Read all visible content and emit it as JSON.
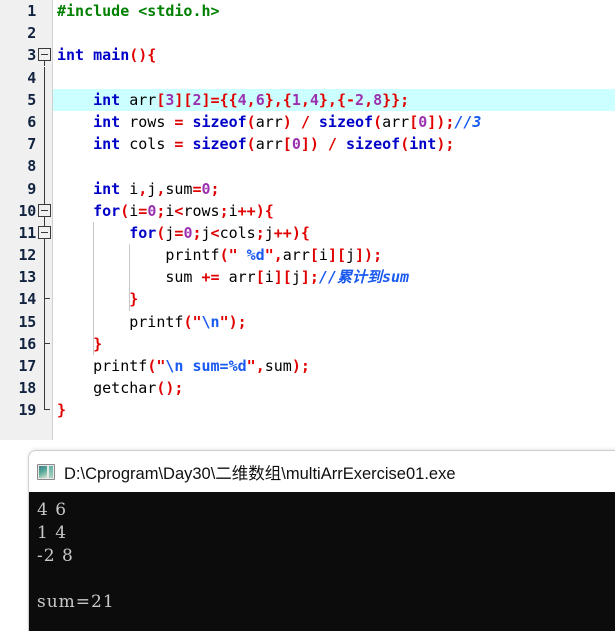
{
  "editor": {
    "name": "c-source-editor",
    "highlight_color": "#CCFFFF",
    "gutter_background": "#F0F0F0",
    "lines": [
      {
        "num": "1",
        "fold": "none",
        "indent_guides": 0,
        "highlight": false,
        "tokens": [
          {
            "t": "#include ",
            "c": "pre"
          },
          {
            "t": "<stdio.h>",
            "c": "pre"
          }
        ]
      },
      {
        "num": "2",
        "fold": "none",
        "indent_guides": 0,
        "highlight": false,
        "tokens": []
      },
      {
        "num": "3",
        "fold": "box",
        "indent_guides": 0,
        "highlight": false,
        "tokens": [
          {
            "t": "int",
            "c": "kw"
          },
          {
            "t": " ",
            "c": "id"
          },
          {
            "t": "main",
            "c": "kw"
          },
          {
            "t": "(){",
            "c": "pun"
          }
        ]
      },
      {
        "num": "4",
        "fold": "line",
        "indent_guides": 0,
        "highlight": false,
        "tokens": []
      },
      {
        "num": "5",
        "fold": "line",
        "indent_guides": 0,
        "highlight": true,
        "tokens": [
          {
            "t": "    ",
            "c": "id"
          },
          {
            "t": "int",
            "c": "kw"
          },
          {
            "t": " arr",
            "c": "id"
          },
          {
            "t": "[",
            "c": "pun"
          },
          {
            "t": "3",
            "c": "num"
          },
          {
            "t": "][",
            "c": "pun"
          },
          {
            "t": "2",
            "c": "num"
          },
          {
            "t": "]",
            "c": "pun"
          },
          {
            "t": "=",
            "c": "op"
          },
          {
            "t": "{{",
            "c": "pun"
          },
          {
            "t": "4",
            "c": "num"
          },
          {
            "t": ",",
            "c": "pun"
          },
          {
            "t": "6",
            "c": "num"
          },
          {
            "t": "},{",
            "c": "pun"
          },
          {
            "t": "1",
            "c": "num"
          },
          {
            "t": ",",
            "c": "pun"
          },
          {
            "t": "4",
            "c": "num"
          },
          {
            "t": "},{",
            "c": "pun"
          },
          {
            "t": "-",
            "c": "op"
          },
          {
            "t": "2",
            "c": "num"
          },
          {
            "t": ",",
            "c": "pun"
          },
          {
            "t": "8",
            "c": "num"
          },
          {
            "t": "}};",
            "c": "pun"
          }
        ]
      },
      {
        "num": "6",
        "fold": "line",
        "indent_guides": 0,
        "highlight": false,
        "tokens": [
          {
            "t": "    ",
            "c": "id"
          },
          {
            "t": "int",
            "c": "kw"
          },
          {
            "t": " rows ",
            "c": "id"
          },
          {
            "t": "=",
            "c": "op"
          },
          {
            "t": " ",
            "c": "id"
          },
          {
            "t": "sizeof",
            "c": "kw"
          },
          {
            "t": "(",
            "c": "pun"
          },
          {
            "t": "arr",
            "c": "id"
          },
          {
            "t": ")",
            "c": "pun"
          },
          {
            "t": " / ",
            "c": "op"
          },
          {
            "t": "sizeof",
            "c": "kw"
          },
          {
            "t": "(",
            "c": "pun"
          },
          {
            "t": "arr",
            "c": "id"
          },
          {
            "t": "[",
            "c": "pun"
          },
          {
            "t": "0",
            "c": "num"
          },
          {
            "t": "]);",
            "c": "pun"
          },
          {
            "t": "//3",
            "c": "cmt"
          }
        ]
      },
      {
        "num": "7",
        "fold": "line",
        "indent_guides": 0,
        "highlight": false,
        "tokens": [
          {
            "t": "    ",
            "c": "id"
          },
          {
            "t": "int",
            "c": "kw"
          },
          {
            "t": " cols ",
            "c": "id"
          },
          {
            "t": "=",
            "c": "op"
          },
          {
            "t": " ",
            "c": "id"
          },
          {
            "t": "sizeof",
            "c": "kw"
          },
          {
            "t": "(",
            "c": "pun"
          },
          {
            "t": "arr",
            "c": "id"
          },
          {
            "t": "[",
            "c": "pun"
          },
          {
            "t": "0",
            "c": "num"
          },
          {
            "t": "])",
            "c": "pun"
          },
          {
            "t": " / ",
            "c": "op"
          },
          {
            "t": "sizeof",
            "c": "kw"
          },
          {
            "t": "(",
            "c": "pun"
          },
          {
            "t": "int",
            "c": "kw"
          },
          {
            "t": ");",
            "c": "pun"
          }
        ]
      },
      {
        "num": "8",
        "fold": "line",
        "indent_guides": 0,
        "highlight": false,
        "tokens": []
      },
      {
        "num": "9",
        "fold": "line",
        "indent_guides": 0,
        "highlight": false,
        "tokens": [
          {
            "t": "    ",
            "c": "id"
          },
          {
            "t": "int",
            "c": "kw"
          },
          {
            "t": " i",
            "c": "id"
          },
          {
            "t": ",",
            "c": "pun"
          },
          {
            "t": "j",
            "c": "id"
          },
          {
            "t": ",",
            "c": "pun"
          },
          {
            "t": "sum",
            "c": "id"
          },
          {
            "t": "=",
            "c": "op"
          },
          {
            "t": "0",
            "c": "num"
          },
          {
            "t": ";",
            "c": "pun"
          }
        ]
      },
      {
        "num": "10",
        "fold": "box",
        "indent_guides": 0,
        "highlight": false,
        "tokens": [
          {
            "t": "    ",
            "c": "id"
          },
          {
            "t": "for",
            "c": "kw"
          },
          {
            "t": "(",
            "c": "pun"
          },
          {
            "t": "i",
            "c": "id"
          },
          {
            "t": "=",
            "c": "op"
          },
          {
            "t": "0",
            "c": "num"
          },
          {
            "t": ";",
            "c": "pun"
          },
          {
            "t": "i",
            "c": "id"
          },
          {
            "t": "<",
            "c": "op"
          },
          {
            "t": "rows",
            "c": "id"
          },
          {
            "t": ";",
            "c": "pun"
          },
          {
            "t": "i",
            "c": "id"
          },
          {
            "t": "++",
            "c": "op"
          },
          {
            "t": "){",
            "c": "pun"
          }
        ]
      },
      {
        "num": "11",
        "fold": "box",
        "indent_guides": 1,
        "highlight": false,
        "tokens": [
          {
            "t": "        ",
            "c": "id"
          },
          {
            "t": "for",
            "c": "kw"
          },
          {
            "t": "(",
            "c": "pun"
          },
          {
            "t": "j",
            "c": "id"
          },
          {
            "t": "=",
            "c": "op"
          },
          {
            "t": "0",
            "c": "num"
          },
          {
            "t": ";",
            "c": "pun"
          },
          {
            "t": "j",
            "c": "id"
          },
          {
            "t": "<",
            "c": "op"
          },
          {
            "t": "cols",
            "c": "id"
          },
          {
            "t": ";",
            "c": "pun"
          },
          {
            "t": "j",
            "c": "id"
          },
          {
            "t": "++",
            "c": "op"
          },
          {
            "t": "){",
            "c": "pun"
          }
        ]
      },
      {
        "num": "12",
        "fold": "line",
        "indent_guides": 2,
        "highlight": false,
        "tokens": [
          {
            "t": "            ",
            "c": "id"
          },
          {
            "t": "printf",
            "c": "id"
          },
          {
            "t": "(",
            "c": "pun"
          },
          {
            "t": "\"",
            "c": "str"
          },
          {
            "t": " ",
            "c": "str"
          },
          {
            "t": "%d",
            "c": "fmt"
          },
          {
            "t": "\"",
            "c": "str"
          },
          {
            "t": ",",
            "c": "pun"
          },
          {
            "t": "arr",
            "c": "id"
          },
          {
            "t": "[",
            "c": "pun"
          },
          {
            "t": "i",
            "c": "id"
          },
          {
            "t": "][",
            "c": "pun"
          },
          {
            "t": "j",
            "c": "id"
          },
          {
            "t": "]);",
            "c": "pun"
          }
        ]
      },
      {
        "num": "13",
        "fold": "line",
        "indent_guides": 2,
        "highlight": false,
        "tokens": [
          {
            "t": "            ",
            "c": "id"
          },
          {
            "t": "sum ",
            "c": "id"
          },
          {
            "t": "+=",
            "c": "op"
          },
          {
            "t": " arr",
            "c": "id"
          },
          {
            "t": "[",
            "c": "pun"
          },
          {
            "t": "i",
            "c": "id"
          },
          {
            "t": "][",
            "c": "pun"
          },
          {
            "t": "j",
            "c": "id"
          },
          {
            "t": "];",
            "c": "pun"
          },
          {
            "t": "//累计到sum",
            "c": "cmt"
          }
        ]
      },
      {
        "num": "14",
        "fold": "tick",
        "indent_guides": 2,
        "highlight": false,
        "tokens": [
          {
            "t": "        ",
            "c": "id"
          },
          {
            "t": "}",
            "c": "pun"
          }
        ]
      },
      {
        "num": "15",
        "fold": "line",
        "indent_guides": 1,
        "highlight": false,
        "tokens": [
          {
            "t": "        ",
            "c": "id"
          },
          {
            "t": "printf",
            "c": "id"
          },
          {
            "t": "(",
            "c": "pun"
          },
          {
            "t": "\"",
            "c": "str"
          },
          {
            "t": "\\n",
            "c": "fmt"
          },
          {
            "t": "\"",
            "c": "str"
          },
          {
            "t": ");",
            "c": "pun"
          }
        ]
      },
      {
        "num": "16",
        "fold": "tick",
        "indent_guides": 1,
        "highlight": false,
        "tokens": [
          {
            "t": "    ",
            "c": "id"
          },
          {
            "t": "}",
            "c": "pun"
          }
        ]
      },
      {
        "num": "17",
        "fold": "line",
        "indent_guides": 0,
        "highlight": false,
        "tokens": [
          {
            "t": "    ",
            "c": "id"
          },
          {
            "t": "printf",
            "c": "id"
          },
          {
            "t": "(",
            "c": "pun"
          },
          {
            "t": "\"",
            "c": "str"
          },
          {
            "t": "\\n sum=%d",
            "c": "fmt"
          },
          {
            "t": "\"",
            "c": "str"
          },
          {
            "t": ",",
            "c": "pun"
          },
          {
            "t": "sum",
            "c": "id"
          },
          {
            "t": ");",
            "c": "pun"
          }
        ]
      },
      {
        "num": "18",
        "fold": "line",
        "indent_guides": 0,
        "highlight": false,
        "tokens": [
          {
            "t": "    ",
            "c": "id"
          },
          {
            "t": "getchar",
            "c": "id"
          },
          {
            "t": "();",
            "c": "pun"
          }
        ]
      },
      {
        "num": "19",
        "fold": "corner",
        "indent_guides": 0,
        "highlight": false,
        "tokens": [
          {
            "t": "}",
            "c": "pun"
          }
        ]
      }
    ]
  },
  "console": {
    "title": "D:\\Cprogram\\Day30\\二维数组\\multiArrExercise01.exe",
    "icon": "console-window-icon",
    "background": "#0C0C0C",
    "text_color": "#C8C8C8",
    "output_lines": [
      "4 6",
      "1 4",
      "-2 8",
      "",
      "sum=21"
    ]
  }
}
